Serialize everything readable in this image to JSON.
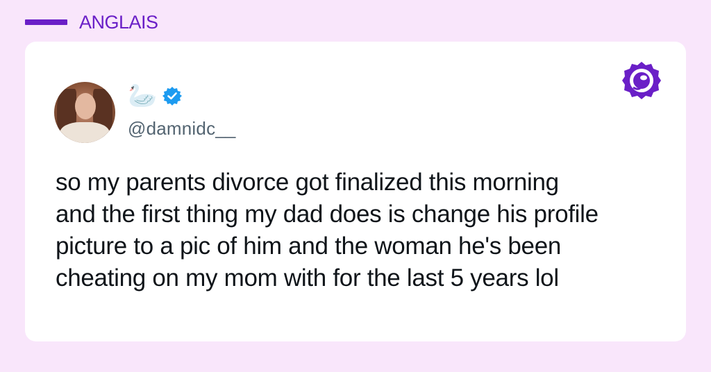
{
  "header": {
    "language_label": "ANGLAIS"
  },
  "tweet": {
    "display_name": "🦢",
    "handle": "@damnidc__",
    "verified": true,
    "text": "so my parents divorce got finalized this morning\nand the first thing my dad does is change his profile\npicture to a pic of him and the woman he's been\ncheating on my mom with for the last 5 years lol"
  },
  "colors": {
    "accent": "#6a1fc7",
    "background": "#f9e6fb",
    "verified_badge": "#1d9bf0"
  },
  "icons": {
    "brand": "brand-logo-icon",
    "verified": "verified-badge-icon"
  }
}
